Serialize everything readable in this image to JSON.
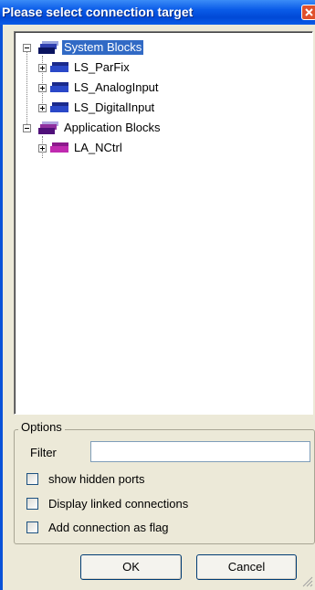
{
  "window": {
    "title": "Please select connection target"
  },
  "tree": {
    "groups": [
      {
        "label": "System Blocks",
        "selected": true,
        "children": [
          {
            "label": "LS_ParFix"
          },
          {
            "label": "LS_AnalogInput"
          },
          {
            "label": "LS_DigitalInput"
          }
        ]
      },
      {
        "label": "Application Blocks",
        "selected": false,
        "children": [
          {
            "label": "LA_NCtrl"
          }
        ]
      }
    ]
  },
  "options": {
    "legend": "Options",
    "filter_label": "Filter",
    "filter_value": "",
    "checkboxes": [
      {
        "label": "show hidden ports",
        "checked": false
      },
      {
        "label": "Display linked connections",
        "checked": false
      },
      {
        "label": "Add connection as flag",
        "checked": false
      }
    ]
  },
  "buttons": {
    "ok_label": "OK",
    "cancel_label": "Cancel"
  },
  "colors": {
    "titlebar": "#0a5be8",
    "selection": "#316ac5",
    "system_block_icon": "#1a2a8c",
    "application_block_icon": "#8c1a8c"
  },
  "icons": {
    "system_group": "blocks-stack-blue-icon",
    "application_group": "blocks-stack-purple-icon",
    "block": "block-icon",
    "close": "close-icon"
  }
}
